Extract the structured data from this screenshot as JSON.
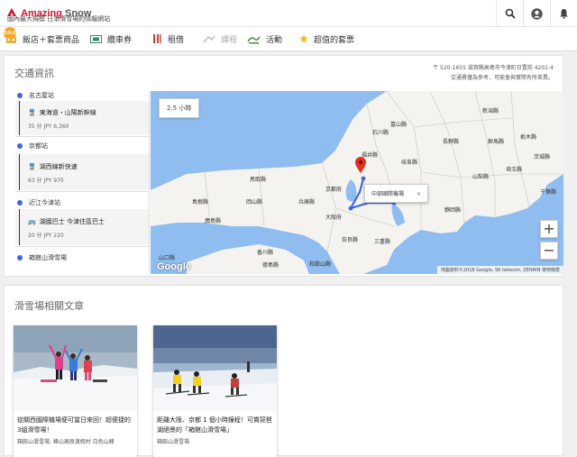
{
  "header": {
    "logo_word": "Amazing",
    "logo_snow": "Snow",
    "tagline": "國內最大規模 日本滑雪場的情報網站",
    "icons": [
      "search-icon",
      "account-icon",
      "notification-bell-icon"
    ]
  },
  "nav": {
    "badge": "SALE",
    "items": [
      {
        "label": "飯店＋套票商品",
        "icon": "hotel-icon"
      },
      {
        "label": "纜車券",
        "icon": "lift-ticket-icon"
      },
      {
        "label": "租借",
        "icon": "ski-rental-icon"
      },
      {
        "label": "課程",
        "icon": "lesson-icon"
      },
      {
        "label": "活動",
        "icon": "activity-icon"
      },
      {
        "label": "超值的套票",
        "icon": "star-icon"
      }
    ]
  },
  "traffic": {
    "title": "交通資訊",
    "address_line1": "〒 520-1655 滋賀縣高島市今津町日置前 4201-4",
    "address_line2": "交通費僅為參考，可能會與實際有所差異。",
    "stops": [
      "名古屋站",
      "京都站",
      "近江今津站",
      "箱館山滑雪場"
    ],
    "segments": [
      {
        "name": "東海道・山陽新幹線",
        "info": "35 分  JPY 6,360"
      },
      {
        "name": "湖西線新快速",
        "info": "63 分  JPY 970"
      },
      {
        "name": "湖國巴士 今津往區巴士",
        "info": "20 分  JPY 220"
      }
    ]
  },
  "map": {
    "duration": "2.5 小時",
    "popup": "中部國際機場",
    "popup_close": "×",
    "zoom_in": "+",
    "zoom_out": "−",
    "google": "Google",
    "attribution": "地圖資料©2018 Google, SK telecom, ZENRIN   使用條款",
    "labels": {
      "toyama": "富山縣",
      "niigata": "新潟縣",
      "ishikawa": "石川縣",
      "nagano": "長野縣",
      "gunma": "群馬縣",
      "tochigi": "栃木縣",
      "ibaraki": "茨城縣",
      "saitama": "埼玉縣",
      "fukui": "福井縣",
      "gifu": "岐阜縣",
      "yamanashi": "山梨縣",
      "chiba": "千葉縣",
      "tottori": "鳥取縣",
      "kyoto": "京都府",
      "shizuoka": "靜岡縣",
      "shimane": "島根縣",
      "okayama": "岡山縣",
      "hyogo": "兵庫縣",
      "osaka": "大阪府",
      "hiroshima": "廣島縣",
      "nara": "奈良縣",
      "mie": "三重縣",
      "kagawa": "香川縣",
      "tokushima": "德島縣",
      "wakayama": "和歌山縣",
      "yamaguchi": "山口縣"
    }
  },
  "articles": {
    "title": "滑雪場相關文章",
    "items": [
      {
        "title": "從關西國際機場便可當日來回！超便捷的3組滑雪場！",
        "sub": "箱館山滑雪場, 峰山高原渡假村 白色山峰"
      },
      {
        "title": "距離大阪、京都 1 個小時鐘程！可賞琵琶湖絕景的「箱館山滑雪場」",
        "sub": "箱館山滑雪場"
      }
    ]
  },
  "colors": {
    "brand": "#d0112b",
    "route_dot": "#3c67e3",
    "sea": "#8fbdf0",
    "land": "#f4f3ef"
  }
}
